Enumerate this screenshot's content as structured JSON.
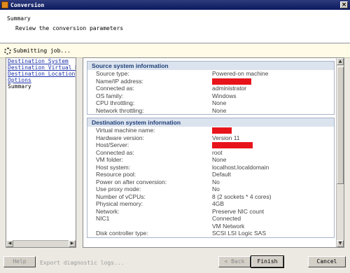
{
  "window": {
    "title": "Conversion",
    "close_glyph": "×"
  },
  "header": {
    "title": "Summary",
    "subtitle": "Review the conversion parameters"
  },
  "status": {
    "text": "Submitting job..."
  },
  "nav": {
    "items": [
      {
        "label": "Destination System",
        "link": true
      },
      {
        "label": "Destination Virtual M",
        "link": true
      },
      {
        "label": "Destination Location",
        "link": true
      },
      {
        "label": "Options",
        "link": true
      },
      {
        "label": "Summary",
        "link": false
      }
    ]
  },
  "source": {
    "header": "Source system information",
    "rows": [
      {
        "label": "Source type:",
        "value": "Powered-on machine"
      },
      {
        "label": "Name/IP address:",
        "value": "",
        "redacted": true
      },
      {
        "label": "Connected as:",
        "value": "administrator"
      },
      {
        "label": "OS family:",
        "value": "Windows"
      },
      {
        "label": "CPU throttling:",
        "value": "None"
      },
      {
        "label": "Network throttling:",
        "value": "None"
      }
    ]
  },
  "destination": {
    "header": "Destination system information",
    "rows": [
      {
        "label": "Virtual machine name:",
        "value": "",
        "redacted": true
      },
      {
        "label": "Hardware version:",
        "value": "Version 11"
      },
      {
        "label": "Host/Server:",
        "value": "",
        "redacted": true
      },
      {
        "label": "Connected as:",
        "value": "root"
      },
      {
        "label": "VM folder:",
        "value": "None"
      },
      {
        "label": "Host system:",
        "value": "localhost.localdomain"
      },
      {
        "label": "Resource pool:",
        "value": "Default"
      },
      {
        "label": "Power on after conversion:",
        "value": "No"
      },
      {
        "label": "Use proxy mode:",
        "value": "No"
      },
      {
        "label": "Number of vCPUs:",
        "value": "8 (2 sockets * 4 cores)"
      },
      {
        "label": "Physical memory:",
        "value": "4GB"
      },
      {
        "label": "Network:",
        "value": "Preserve NIC count"
      },
      {
        "label": "NIC1",
        "value": "Connected"
      },
      {
        "label": "",
        "value": "VM Network"
      },
      {
        "label": "Disk controller type:",
        "value": "SCSI LSI Logic SAS"
      }
    ]
  },
  "footer": {
    "help": "Help",
    "export": "Export diagnostic logs...",
    "back": "< Back",
    "finish": "Finish",
    "cancel": "Cancel"
  },
  "colors": {
    "redaction": "#e8141b",
    "section_header_text": "#1f3f79",
    "link": "#1a2fa8"
  }
}
